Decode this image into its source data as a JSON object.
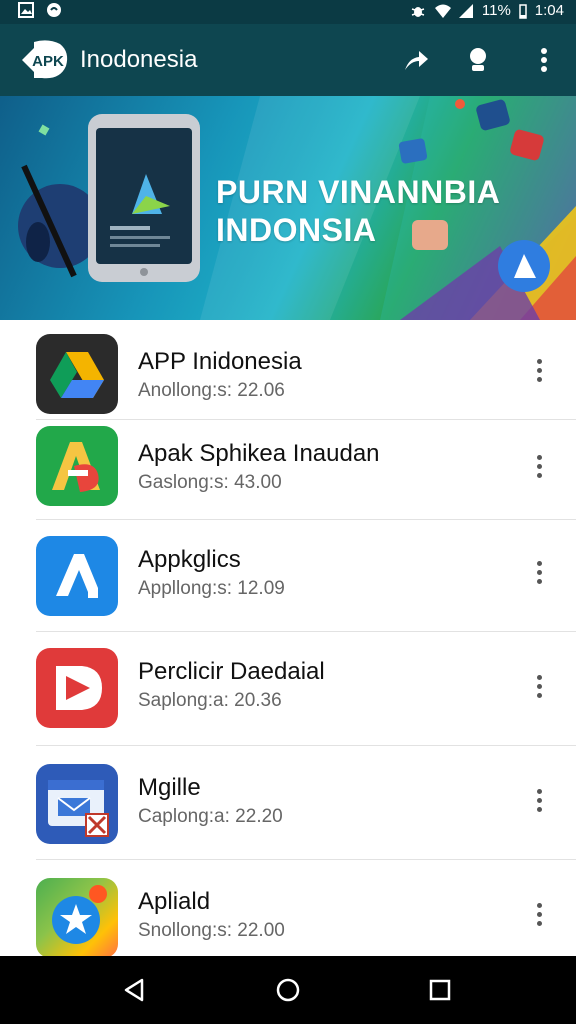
{
  "status_bar": {
    "battery": "11%",
    "time": "1:04",
    "icons": [
      "gallery-icon",
      "whatsapp-icon",
      "bug-icon",
      "wifi-icon",
      "signal-icon",
      "battery-icon"
    ]
  },
  "app_bar": {
    "logo_text": "APK",
    "title": "Inodonesia",
    "actions": [
      "share-icon",
      "account-icon",
      "more-vert-icon"
    ]
  },
  "banner": {
    "line1": "PURN VINANNBIA",
    "line2": "INDONSIA"
  },
  "apps": [
    {
      "name": "APP Inidonesia",
      "sub": "Anollong:s: 22.06",
      "icon": "drive-icon"
    },
    {
      "name": "Apak Sphikea Inaudan",
      "sub": "Gaslong:s: 43.00",
      "icon": "aps-icon"
    },
    {
      "name": "Appkglics",
      "sub": "Appllong:s: 12.09",
      "icon": "a-store-icon"
    },
    {
      "name": "Perclicir Daedaial",
      "sub": "Saplong:a: 20.36",
      "icon": "play-d-icon"
    },
    {
      "name": "Mgille",
      "sub": "Caplong:a: 22.20",
      "icon": "mail-calendar-icon"
    },
    {
      "name": "Apliald",
      "sub": "Snollong:s: 22.00",
      "icon": "star-clock-icon"
    }
  ],
  "nav": [
    "back-icon",
    "home-icon",
    "recents-icon"
  ]
}
